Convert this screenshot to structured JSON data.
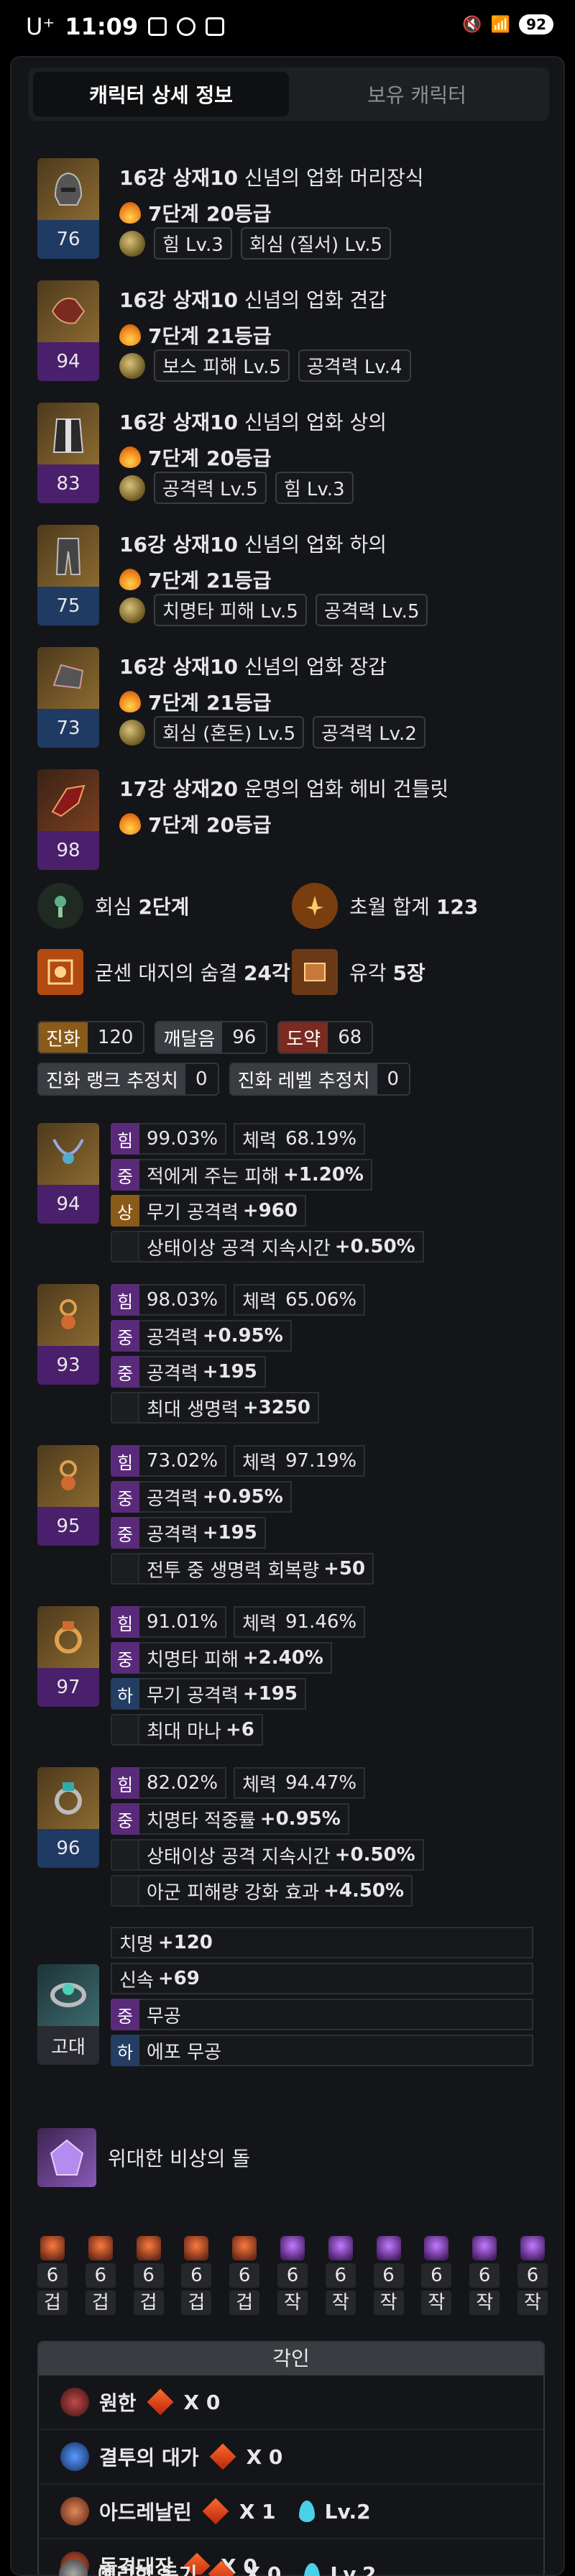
{
  "status_bar": {
    "carrier": "U⁺",
    "time": "11:09",
    "battery": "92"
  },
  "tabs": [
    {
      "label": "캐릭터 상세 정보",
      "active": true
    },
    {
      "label": "보유 캐릭터",
      "active": false
    }
  ],
  "equipment": [
    {
      "icon": "helmet-icon",
      "name_prefix": "16강 상재10",
      "name_rest": "신념의 업화 머리장식",
      "ilvl": "76",
      "tier_text": "7단계",
      "tier_grade": "20등급",
      "abilities": [
        "힘 Lv.3",
        "회심 (질서) Lv.5"
      ]
    },
    {
      "icon": "shoulder-icon",
      "name_prefix": "16강 상재10",
      "name_rest": "신념의 업화 견갑",
      "ilvl": "94",
      "tier_text": "7단계",
      "tier_grade": "21등급",
      "abilities": [
        "보스 피해 Lv.5",
        "공격력 Lv.4"
      ]
    },
    {
      "icon": "chest-icon",
      "name_prefix": "16강 상재10",
      "name_rest": "신념의 업화 상의",
      "ilvl": "83",
      "tier_text": "7단계",
      "tier_grade": "20등급",
      "abilities": [
        "공격력 Lv.5",
        "힘 Lv.3"
      ]
    },
    {
      "icon": "pants-icon",
      "name_prefix": "16강 상재10",
      "name_rest": "신념의 업화 하의",
      "ilvl": "75",
      "tier_text": "7단계",
      "tier_grade": "21등급",
      "abilities": [
        "치명타 피해 Lv.5",
        "공격력 Lv.5"
      ]
    },
    {
      "icon": "gloves-icon",
      "name_prefix": "16강 상재10",
      "name_rest": "신념의 업화 장갑",
      "ilvl": "73",
      "tier_text": "7단계",
      "tier_grade": "21등급",
      "abilities": [
        "회심 (혼돈) Lv.5",
        "공격력 Lv.2"
      ]
    },
    {
      "icon": "weapon-icon",
      "name_prefix": "17강 상재20",
      "name_rest": "운명의 업화 헤비 건틀릿",
      "ilvl": "98",
      "tier_text": "7단계",
      "tier_grade": "20등급",
      "abilities": []
    }
  ],
  "summary": {
    "crit_label": "회심",
    "crit_value": "2단계",
    "transcend_label": "초월 합계",
    "transcend_value": "123",
    "bracelet_label": "굳센 대지의 숨결",
    "bracelet_value": "24각",
    "relic_label": "유각",
    "relic_value": "5장"
  },
  "ark": {
    "evolution": {
      "label": "진화",
      "value": "120"
    },
    "enlightenment": {
      "label": "깨달음",
      "value": "96"
    },
    "leap": {
      "label": "도약",
      "value": "68"
    },
    "rank_est": {
      "label": "진화 랭크 추정치",
      "value": "0"
    },
    "level_est": {
      "label": "진화 레벨 추정치",
      "value": "0"
    }
  },
  "accessories": [
    {
      "icon": "necklace-icon",
      "ilvl": "94",
      "stat1_k": "힘",
      "stat1_v": "99.03%",
      "stat2_k": "체력",
      "stat2_v": "68.19%",
      "lines": [
        {
          "tag": "중",
          "text": "적에게 주는 피해",
          "bold": "+1.20%"
        },
        {
          "tag": "상",
          "text": "무기 공격력",
          "bold": "+960"
        },
        {
          "tag": "",
          "text": "상태이상 공격 지속시간",
          "bold": "+0.50%"
        }
      ]
    },
    {
      "icon": "earring-icon",
      "ilvl": "93",
      "stat1_k": "힘",
      "stat1_v": "98.03%",
      "stat2_k": "체력",
      "stat2_v": "65.06%",
      "lines": [
        {
          "tag": "중",
          "text": "공격력",
          "bold": "+0.95%"
        },
        {
          "tag": "중",
          "text": "공격력",
          "bold": "+195"
        },
        {
          "tag": "",
          "text": "최대 생명력",
          "bold": "+3250"
        }
      ]
    },
    {
      "icon": "earring-icon",
      "ilvl": "95",
      "stat1_k": "힘",
      "stat1_v": "73.02%",
      "stat2_k": "체력",
      "stat2_v": "97.19%",
      "lines": [
        {
          "tag": "중",
          "text": "공격력",
          "bold": "+0.95%"
        },
        {
          "tag": "중",
          "text": "공격력",
          "bold": "+195"
        },
        {
          "tag": "",
          "text": "전투 중 생명력 회복량",
          "bold": "+50"
        }
      ]
    },
    {
      "icon": "ring-icon",
      "ilvl": "97",
      "stat1_k": "힘",
      "stat1_v": "91.01%",
      "stat2_k": "체력",
      "stat2_v": "91.46%",
      "lines": [
        {
          "tag": "중",
          "text": "치명타 피해",
          "bold": "+2.40%"
        },
        {
          "tag": "하",
          "text": "무기 공격력",
          "bold": "+195"
        },
        {
          "tag": "",
          "text": "최대 마나",
          "bold": "+6"
        }
      ]
    },
    {
      "icon": "ring-icon",
      "ilvl": "96",
      "stat1_k": "힘",
      "stat1_v": "82.02%",
      "stat2_k": "체력",
      "stat2_v": "94.47%",
      "lines": [
        {
          "tag": "중",
          "text": "치명타 적중률",
          "bold": "+0.95%"
        },
        {
          "tag": "",
          "text": "상태이상 공격 지속시간",
          "bold": "+0.50%"
        },
        {
          "tag": "",
          "text": "아군 피해량 강화 효과",
          "bold": "+4.50%"
        }
      ]
    }
  ],
  "bracelet": {
    "icon": "bracelet-icon",
    "grade": "고대",
    "lines": [
      {
        "tag": "",
        "text": "치명",
        "bold": "+120"
      },
      {
        "tag": "",
        "text": "신속",
        "bold": "+69"
      },
      {
        "tag": "중",
        "text": "무공",
        "bold": ""
      },
      {
        "tag": "하",
        "text": "에포 무공",
        "bold": ""
      }
    ]
  },
  "ability_stone": {
    "icon": "stone-icon",
    "name": "위대한 비상의 돌"
  },
  "gems": [
    {
      "level": "6",
      "type": "겁"
    },
    {
      "level": "6",
      "type": "겁"
    },
    {
      "level": "6",
      "type": "겁"
    },
    {
      "level": "6",
      "type": "겁"
    },
    {
      "level": "6",
      "type": "겁"
    },
    {
      "level": "6",
      "type": "작"
    },
    {
      "level": "6",
      "type": "작"
    },
    {
      "level": "6",
      "type": "작"
    },
    {
      "level": "6",
      "type": "작"
    },
    {
      "level": "6",
      "type": "작"
    },
    {
      "level": "6",
      "type": "작"
    }
  ],
  "engravings": {
    "title": "각인",
    "items": [
      {
        "icon": "grudge-icon",
        "name": "원한",
        "relic": "X 0",
        "stone": ""
      },
      {
        "icon": "duel-price-icon",
        "name": "결투의 대가",
        "relic": "X 0",
        "stone": ""
      },
      {
        "icon": "adrenaline-icon",
        "name": "아드레날린",
        "relic": "X 1",
        "stone": "Lv.2"
      },
      {
        "icon": "raid-captain-icon",
        "name": "돌격대장",
        "relic": "X 0",
        "stone": ""
      },
      {
        "icon": "keen-blunt-icon",
        "name": "예리한 둔기",
        "relic": "X 0",
        "stone": "Lv.2"
      }
    ]
  },
  "colors": {
    "ilvl_purple": "#4a1f6b",
    "ilvl_blue": "#1f3a63",
    "tag_purple": "#5a2a7a",
    "tag_orange": "#8a5a18",
    "tag_blue": "#243e63"
  }
}
